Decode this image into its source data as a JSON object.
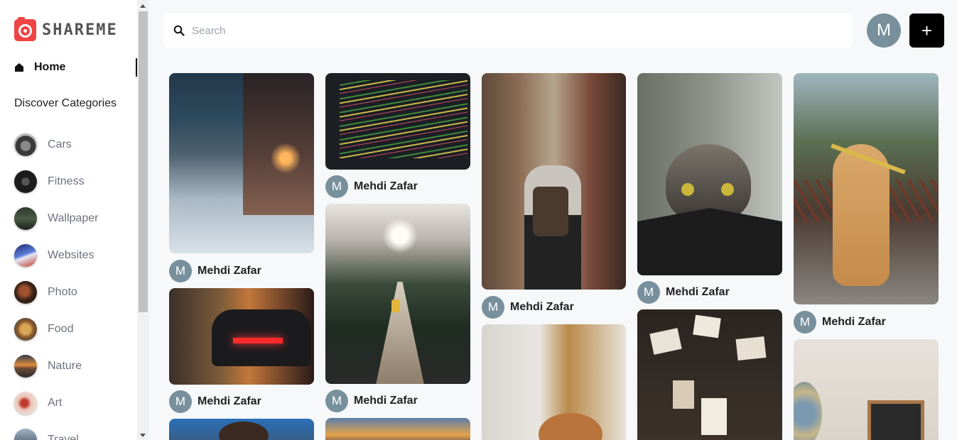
{
  "brand": {
    "logo_text": "SHAREME",
    "logo_color": "#ef4444"
  },
  "nav": {
    "home_label": "Home",
    "discover_heading": "Discover Categories"
  },
  "categories": [
    {
      "label": "Cars"
    },
    {
      "label": "Fitness"
    },
    {
      "label": "Wallpaper"
    },
    {
      "label": "Websites"
    },
    {
      "label": "Photo"
    },
    {
      "label": "Food"
    },
    {
      "label": "Nature"
    },
    {
      "label": "Art"
    },
    {
      "label": "Travel"
    }
  ],
  "search": {
    "placeholder": "Search",
    "value": ""
  },
  "user": {
    "avatar_initial": "M"
  },
  "add_button": {
    "label": "+"
  },
  "pins": [
    {
      "subject": "snowy street at night",
      "author_initial": "M",
      "author": "Mehdi Zafar"
    },
    {
      "subject": "code on screen",
      "author_initial": "M",
      "author": "Mehdi Zafar"
    },
    {
      "subject": "woman with backpack in alley",
      "author_initial": "M",
      "author": "Mehdi Zafar"
    },
    {
      "subject": "cat peeking",
      "author_initial": "M",
      "author": "Mehdi Zafar"
    },
    {
      "subject": "golden retriever with flower",
      "author_initial": "M",
      "author": "Mehdi Zafar"
    },
    {
      "subject": "red car taillights",
      "author_initial": "M",
      "author": "Mehdi Zafar"
    },
    {
      "subject": "suspension bridge in mountains",
      "author_initial": "M",
      "author": "Mehdi Zafar"
    },
    {
      "subject": "cat by window",
      "author_initial": null,
      "author": null
    },
    {
      "subject": "hanging notes",
      "author_initial": null,
      "author": null
    },
    {
      "subject": "letter board sign",
      "author_initial": null,
      "author": null
    },
    {
      "subject": "portrait",
      "author_initial": null,
      "author": null
    },
    {
      "subject": "mountain sunset",
      "author_initial": null,
      "author": null
    }
  ]
}
